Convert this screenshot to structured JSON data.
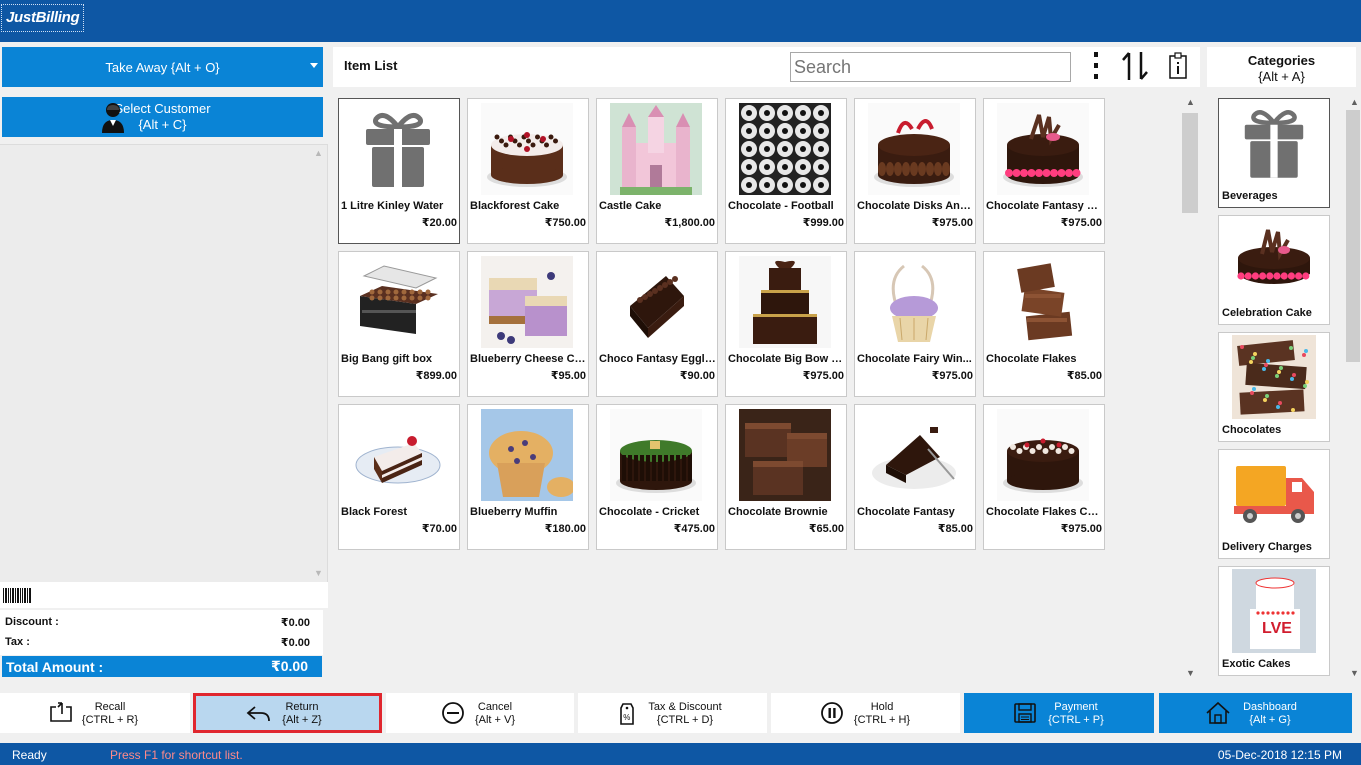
{
  "app": {
    "logo_text": "JustBilling"
  },
  "left_panel": {
    "order_type": "Take Away {Alt + O}",
    "select_customer_line1": "Select Customer",
    "select_customer_line2": "{Alt + C}",
    "discount_label": "Discount :",
    "discount_value": "₹0.00",
    "tax_label": "Tax :",
    "tax_value": "₹0.00",
    "total_label": "Total Amount :",
    "total_value": "₹0.00"
  },
  "item_list": {
    "title": "Item List",
    "search_placeholder": "Search",
    "items": [
      {
        "name": "1 Litre Kinley Water",
        "price": "₹20.00",
        "thumb": "gift-icon"
      },
      {
        "name": "Blackforest Cake",
        "price": "₹750.00",
        "thumb": "blackforest-cake-photo"
      },
      {
        "name": "Castle Cake",
        "price": "₹1,800.00",
        "thumb": "castle-cake-photo"
      },
      {
        "name": "Chocolate - Football",
        "price": "₹999.00",
        "thumb": "football-chocolates-photo"
      },
      {
        "name": "Chocolate Disks And...",
        "price": "₹975.00",
        "thumb": "chocolate-disks-cake-photo"
      },
      {
        "name": "Chocolate Fantasy C...",
        "price": "₹975.00",
        "thumb": "chocolate-fantasy-cake-photo"
      },
      {
        "name": "Big Bang gift box",
        "price": "₹899.00",
        "thumb": "gift-box-photo"
      },
      {
        "name": "Blueberry Cheese Ca...",
        "price": "₹95.00",
        "thumb": "blueberry-cheesecake-photo"
      },
      {
        "name": "Choco Fantasy Eggle...",
        "price": "₹90.00",
        "thumb": "choco-fantasy-slice-photo"
      },
      {
        "name": "Chocolate Big Bow C...",
        "price": "₹975.00",
        "thumb": "big-bow-cake-photo"
      },
      {
        "name": "Chocolate Fairy Win...",
        "price": "₹975.00",
        "thumb": "fairy-cupcake-photo"
      },
      {
        "name": "Chocolate Flakes",
        "price": "₹85.00",
        "thumb": "chocolate-flakes-photo"
      },
      {
        "name": "Black Forest",
        "price": "₹70.00",
        "thumb": "black-forest-slice-photo"
      },
      {
        "name": "Blueberry Muffin",
        "price": "₹180.00",
        "thumb": "blueberry-muffin-photo"
      },
      {
        "name": "Chocolate - Cricket",
        "price": "₹475.00",
        "thumb": "cricket-cake-photo"
      },
      {
        "name": "Chocolate Brownie",
        "price": "₹65.00",
        "thumb": "brownie-photo"
      },
      {
        "name": "Chocolate Fantasy",
        "price": "₹85.00",
        "thumb": "chocolate-fantasy-slice-photo"
      },
      {
        "name": "Chocolate Flakes Cake",
        "price": "₹975.00",
        "thumb": "flakes-cake-photo"
      }
    ]
  },
  "categories": {
    "title": "Categories",
    "shortcut": "{Alt + A}",
    "items": [
      {
        "name": "Beverages",
        "thumb": "gift-icon"
      },
      {
        "name": "Celebration Cake",
        "thumb": "celebration-cake-photo"
      },
      {
        "name": "Chocolates",
        "thumb": "chocolate-bark-photo"
      },
      {
        "name": "Delivery Charges",
        "thumb": "delivery-truck-icon"
      },
      {
        "name": "Exotic Cakes",
        "thumb": "exotic-cake-photo"
      }
    ]
  },
  "actions": [
    {
      "label": "Recall",
      "shortcut": "{CTRL + R}",
      "icon": "recall-icon"
    },
    {
      "label": "Return",
      "shortcut": "{Alt + Z}",
      "icon": "return-icon"
    },
    {
      "label": "Cancel",
      "shortcut": "{Alt + V}",
      "icon": "cancel-icon"
    },
    {
      "label": "Tax & Discount",
      "shortcut": "{CTRL + D}",
      "icon": "tax-tag-icon"
    },
    {
      "label": "Hold",
      "shortcut": "{CTRL + H}",
      "icon": "pause-icon"
    },
    {
      "label": "Payment",
      "shortcut": "{CTRL + P}",
      "icon": "payment-icon"
    },
    {
      "label": "Dashboard",
      "shortcut": "{Alt + G}",
      "icon": "home-icon"
    }
  ],
  "status": {
    "state": "Ready",
    "hint": "Press F1 for shortcut list.",
    "datetime": "05-Dec-2018 12:15 PM"
  },
  "colors": {
    "header_blue": "#0e57a4",
    "button_blue": "#0a84d6",
    "selected_action": "#b9d7ef",
    "highlight_red": "#e0262e",
    "hint_text": "#ff8a8a"
  }
}
